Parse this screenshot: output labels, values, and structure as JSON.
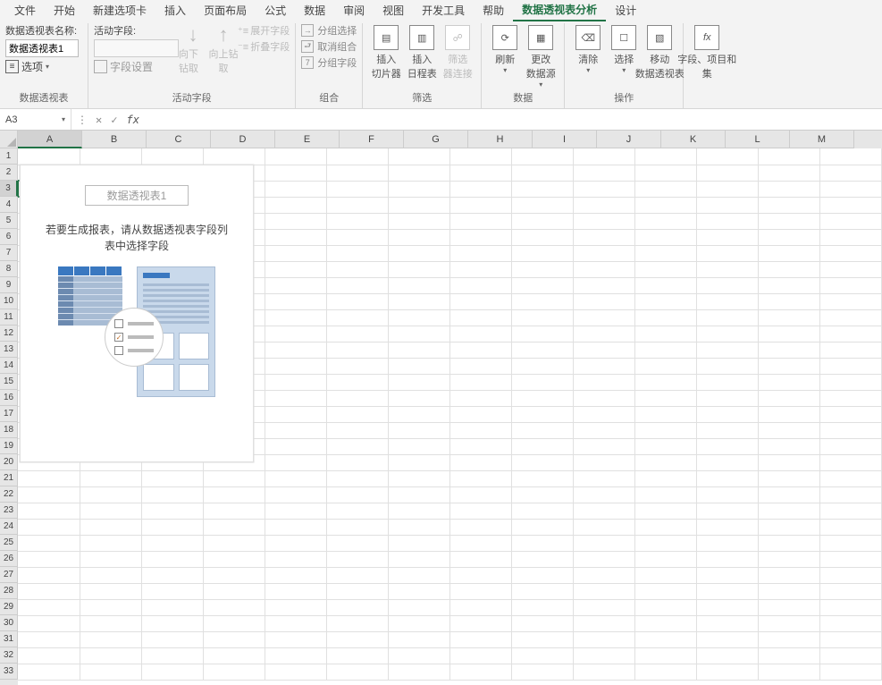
{
  "tabs": [
    "文件",
    "开始",
    "新建选项卡",
    "插入",
    "页面布局",
    "公式",
    "数据",
    "审阅",
    "视图",
    "开发工具",
    "帮助",
    "数据透视表分析",
    "设计"
  ],
  "active_tab_index": 11,
  "ribbon": {
    "g1": {
      "label": "数据透视表",
      "name_lbl": "数据透视表名称:",
      "name_val": "数据透视表1",
      "options": "选项"
    },
    "g2": {
      "label": "活动字段",
      "active_lbl": "活动字段:",
      "field_settings": "字段设置",
      "down": "向下钻取",
      "up": "向上钻\n取",
      "expand": "展开字段",
      "collapse": "折叠字段"
    },
    "g3": {
      "label": "组合",
      "gsel": "分组选择",
      "ungrp": "取消组合",
      "gfld": "分组字段"
    },
    "g4": {
      "label": "筛选",
      "slicer": "插入\n切片器",
      "timeline": "插入\n日程表",
      "conn": "筛选\n器连接"
    },
    "g5": {
      "label": "数据",
      "refresh": "刷新",
      "change": "更改\n数据源"
    },
    "g6": {
      "label": "操作",
      "clear": "清除",
      "select": "选择",
      "move": "移动\n数据透视表"
    },
    "g7": {
      "fields": "字段、项目和\n集"
    }
  },
  "cell_ref": "A3",
  "columns": [
    "A",
    "B",
    "C",
    "D",
    "E",
    "F",
    "G",
    "H",
    "I",
    "J",
    "K",
    "L",
    "M"
  ],
  "rows": [
    "1",
    "2",
    "3",
    "4",
    "5",
    "6",
    "7",
    "8",
    "9",
    "10",
    "11",
    "12",
    "13",
    "14",
    "15",
    "16",
    "17",
    "18",
    "19",
    "20",
    "21",
    "22",
    "23",
    "24",
    "25",
    "26",
    "27",
    "28",
    "29",
    "30",
    "31",
    "32",
    "33"
  ],
  "selected_col": 0,
  "selected_row": 2,
  "pivot": {
    "title": "数据透视表1",
    "msg": "若要生成报表，请从数据透视表字段列\n表中选择字段"
  }
}
